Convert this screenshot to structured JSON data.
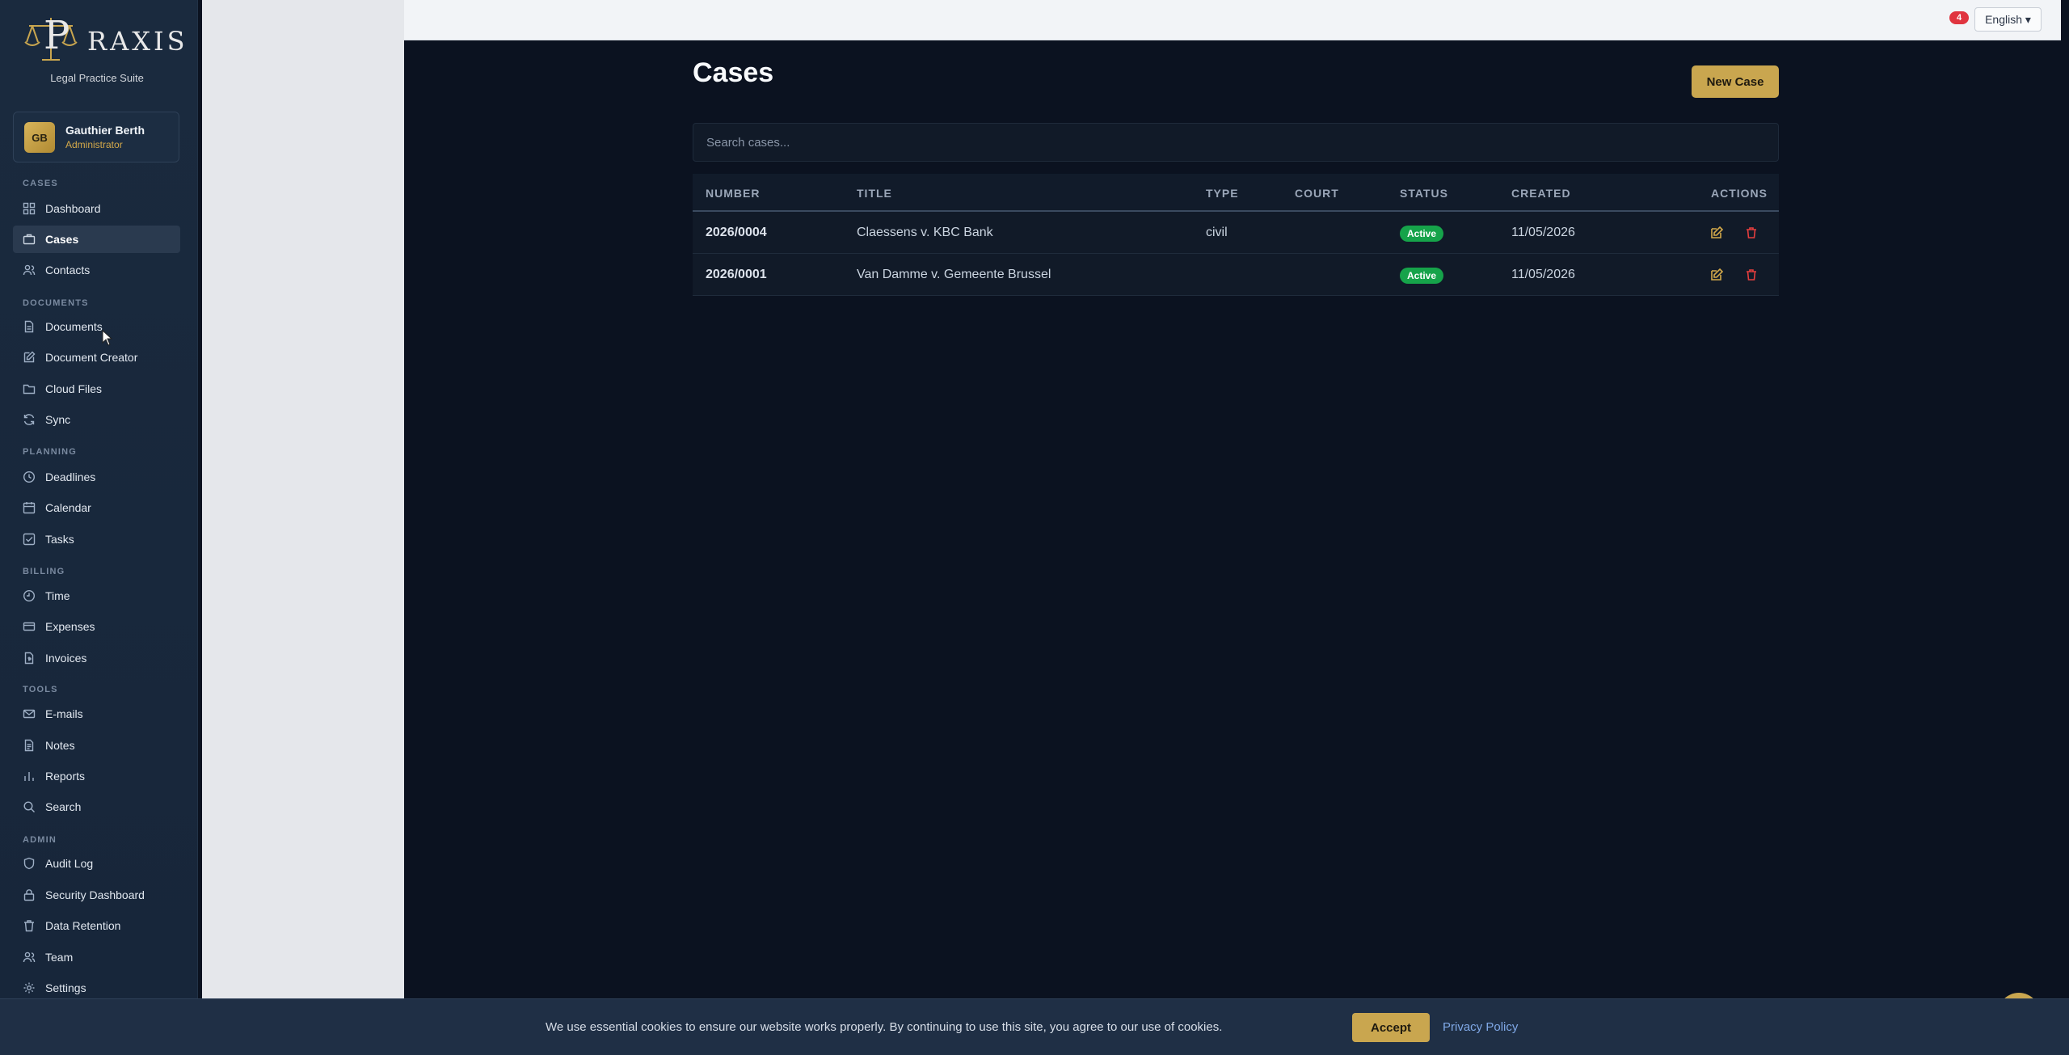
{
  "brand": {
    "logo_text": "RAXIS",
    "tagline": "Legal Practice Suite"
  },
  "user": {
    "initials": "GB",
    "name": "Gauthier Berth",
    "role": "Administrator"
  },
  "nav": {
    "sections": {
      "cases": "CASES",
      "documents": "DOCUMENTS",
      "planning": "PLANNING",
      "billing": "BILLING",
      "tools": "TOOLS",
      "admin": "ADMIN"
    },
    "items": {
      "dashboard": "Dashboard",
      "cases": "Cases",
      "contacts": "Contacts",
      "documents": "Documents",
      "document_creator": "Document Creator",
      "cloud_files": "Cloud Files",
      "sync": "Sync",
      "deadlines": "Deadlines",
      "calendar": "Calendar",
      "tasks": "Tasks",
      "time": "Time",
      "expenses": "Expenses",
      "invoices": "Invoices",
      "emails": "E-mails",
      "notes": "Notes",
      "reports": "Reports",
      "search": "Search",
      "audit_log": "Audit Log",
      "security_dashboard": "Security Dashboard",
      "data_retention": "Data Retention",
      "team": "Team",
      "settings": "Settings"
    },
    "active": "cases"
  },
  "topbar": {
    "notification_count": "4",
    "language": "English ▾"
  },
  "page": {
    "title": "Cases",
    "new_button": "New Case",
    "search_placeholder": "Search cases..."
  },
  "table": {
    "columns": {
      "number": "NUMBER",
      "title": "TITLE",
      "type": "TYPE",
      "court": "COURT",
      "status": "STATUS",
      "created": "CREATED",
      "actions": "ACTIONS"
    },
    "rows": [
      {
        "number": "2026/0004",
        "title": "Claessens v. KBC Bank",
        "type": "civil",
        "court": "",
        "status": "Active",
        "created": "11/05/2026"
      },
      {
        "number": "2026/0001",
        "title": "Van Damme v. Gemeente Brussel",
        "type": "",
        "court": "",
        "status": "Active",
        "created": "11/05/2026"
      }
    ]
  },
  "cookie": {
    "text": "We use essential cookies to ensure our website works properly. By continuing to use this site, you agree to our use of cookies.",
    "accept": "Accept",
    "privacy": "Privacy Policy"
  },
  "colors": {
    "accent": "#c9a64f",
    "sidebar_bg": "#1a2a3e",
    "main_bg": "#0b1220",
    "status_active": "#16a34a",
    "danger": "#e53e3e"
  }
}
